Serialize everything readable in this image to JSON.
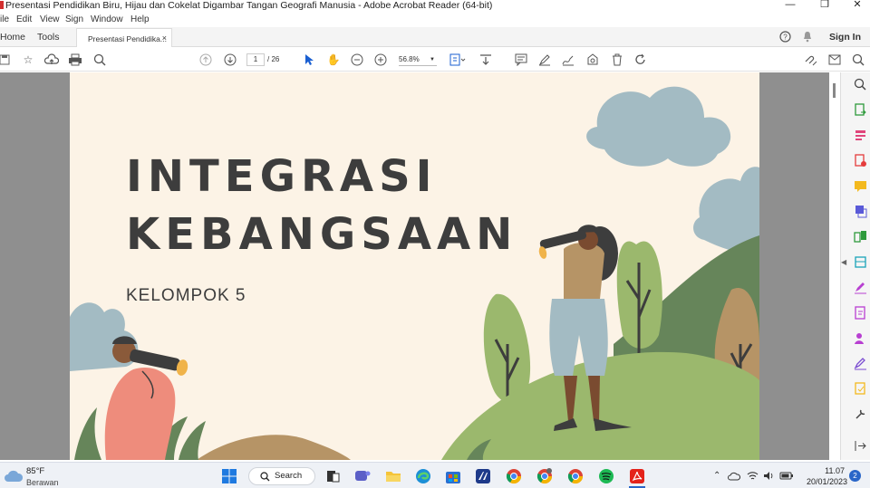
{
  "window": {
    "title": "Presentasi Pendidikan Biru, Hijau dan Cokelat Digambar Tangan Geografi Manusia - Adobe Acrobat Reader (64-bit)"
  },
  "menu": [
    "ile",
    "Edit",
    "View",
    "Sign",
    "Window",
    "Help"
  ],
  "tabs": {
    "home": "Home",
    "tools": "Tools",
    "document": "Presentasi Pendidika...",
    "close": "×",
    "sign_in": "Sign In"
  },
  "toolbar": {
    "page_current": "1",
    "page_total": "/ 26",
    "zoom": "56.8%"
  },
  "slide": {
    "title_line1": "INTEGRASI",
    "title_line2": "KEBANGSAAN",
    "subtitle": "KELOMPOK 5",
    "colors": {
      "background": "#fcf3e6",
      "cloud": "#a3bbc3",
      "hill_light": "#9bb86d",
      "hill_dark": "#66855a",
      "earth": "#b69466",
      "text": "#3d3d3d"
    }
  },
  "taskbar": {
    "temperature": "85°F",
    "weather": "Berawan",
    "search_label": "Search",
    "time": "11.07",
    "date": "20/01/2023",
    "notification_count": "2"
  }
}
